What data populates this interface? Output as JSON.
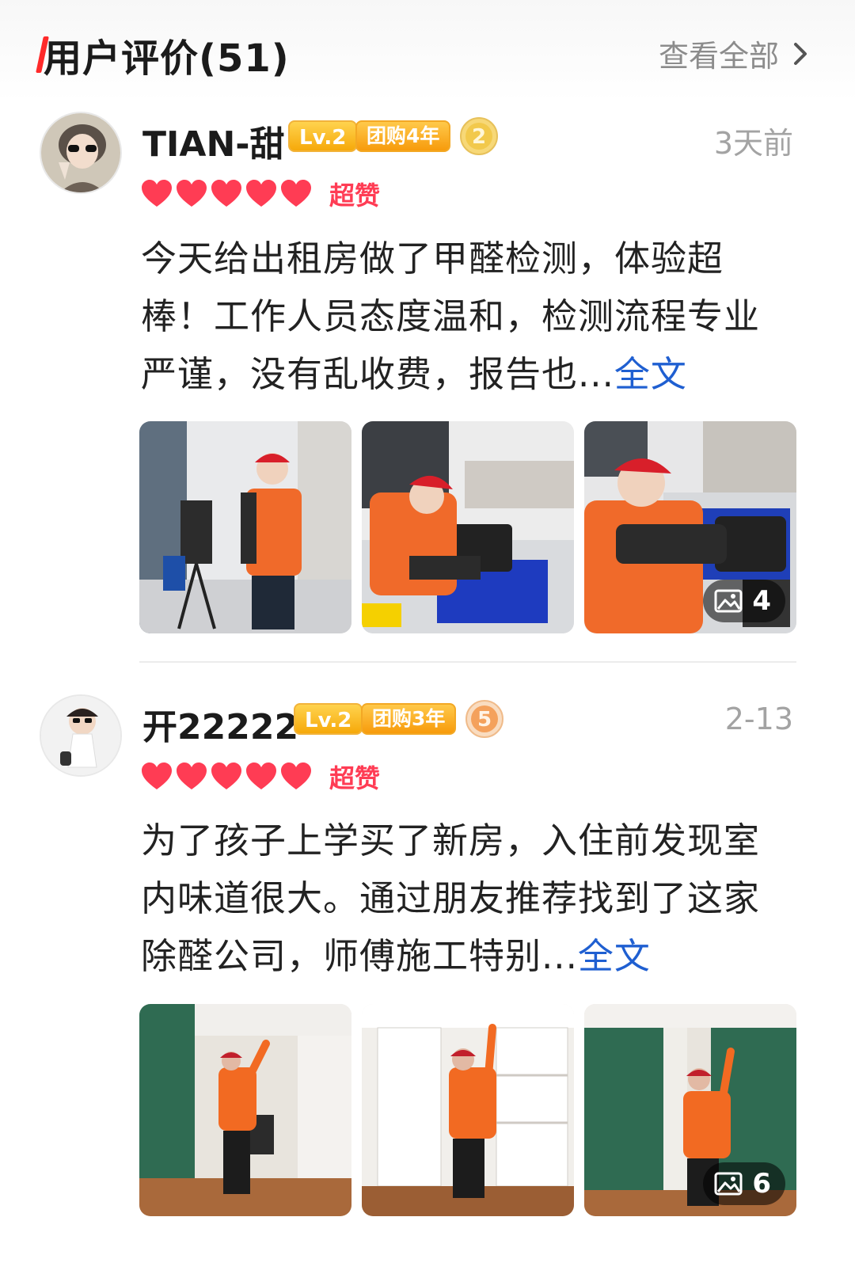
{
  "header": {
    "title": "用户评价(51)",
    "see_all": "查看全部"
  },
  "reviews": [
    {
      "username": "TIAN-甜",
      "level": "Lv.2",
      "group_badge": "团购4年",
      "medal_number": "2",
      "time": "3天前",
      "rating": 5,
      "rating_label": "超赞",
      "text": "今天给出租房做了甲醛检测，体验超棒！工作人员态度温和，检测流程专业严谨，没有乱收费，报告也...",
      "more_label": "全文",
      "photo_count": "4"
    },
    {
      "username": "开22222",
      "level": "Lv.2",
      "group_badge": "团购3年",
      "medal_number": "5",
      "time": "2-13",
      "rating": 5,
      "rating_label": "超赞",
      "text": "为了孩子上学买了新房，入住前发现室内味道很大。通过朋友推荐找到了这家除醛公司，师傅施工特别...",
      "more_label": "全文",
      "photo_count": "6"
    }
  ],
  "colors": {
    "accent_red": "#ff2a2a",
    "heart": "#ff3c54",
    "link": "#1f5fd1",
    "badge_orange": "#f6a90a"
  },
  "icons": {
    "chevron": "chevron-right-icon",
    "heart": "heart-icon",
    "gallery": "image-gallery-icon",
    "medal": "medal-icon"
  }
}
